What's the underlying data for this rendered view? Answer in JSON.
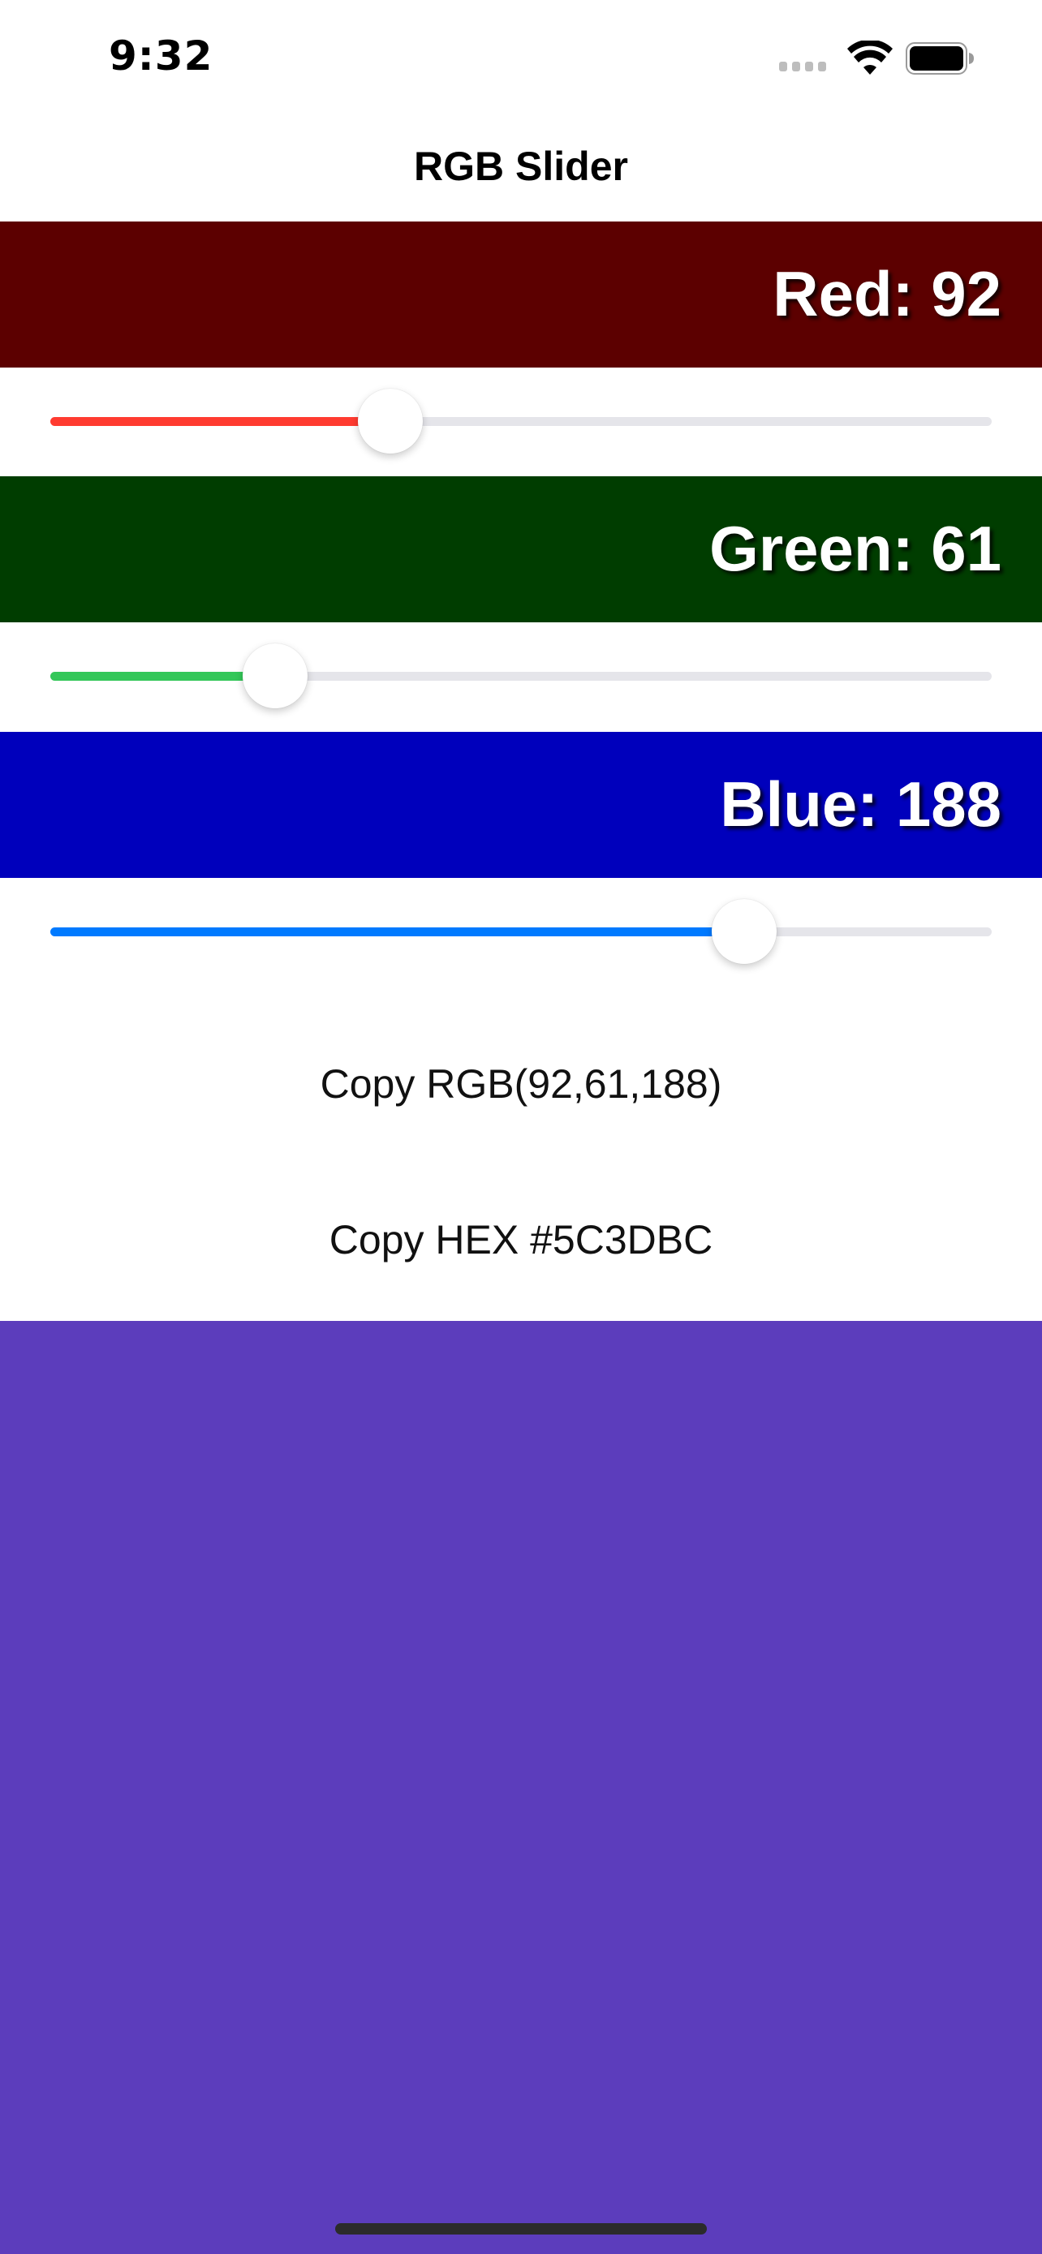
{
  "status_bar": {
    "time": "9:32",
    "icons": [
      "signal-icon",
      "wifi-icon",
      "battery-icon"
    ]
  },
  "nav": {
    "title": "RGB Slider"
  },
  "channels": [
    {
      "key": "red",
      "label": "Red: 92",
      "value": 92,
      "max": 255,
      "band_color": "#5c0000",
      "track_color": "#ff3b30"
    },
    {
      "key": "green",
      "label": "Green: 61",
      "value": 61,
      "max": 255,
      "band_color": "#003d00",
      "track_color": "#34c759"
    },
    {
      "key": "blue",
      "label": "Blue: 188",
      "value": 188,
      "max": 255,
      "band_color": "#0000bc",
      "track_color": "#007aff"
    }
  ],
  "actions": {
    "copy_rgb": "Copy RGB(92,61,188)",
    "copy_hex": "Copy HEX #5C3DBC"
  },
  "preview": {
    "color": "#5c3dbc"
  }
}
